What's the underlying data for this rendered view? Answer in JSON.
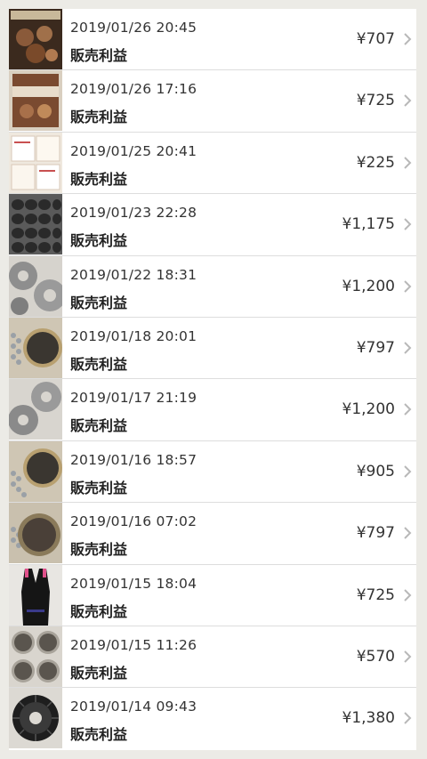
{
  "items": [
    {
      "date": "2019/01/26 20:45",
      "label": "販売利益",
      "amount": "¥707",
      "thumb": "book-cover-cookies",
      "thumb_color": "#6b4a2e"
    },
    {
      "date": "2019/01/26 17:16",
      "label": "販売利益",
      "amount": "¥725",
      "thumb": "book-cover-baking",
      "thumb_color": "#8a5a3a"
    },
    {
      "date": "2019/01/25 20:41",
      "label": "販売利益",
      "amount": "¥225",
      "thumb": "document-sheets",
      "thumb_color": "#e9e2d8"
    },
    {
      "date": "2019/01/23 22:28",
      "label": "販売利益",
      "amount": "¥1,175",
      "thumb": "madeleine-pan",
      "thumb_color": "#4a4a4a"
    },
    {
      "date": "2019/01/22 18:31",
      "label": "販売利益",
      "amount": "¥1,200",
      "thumb": "ring-mold-pans",
      "thumb_color": "#9a9a9a"
    },
    {
      "date": "2019/01/18 20:01",
      "label": "販売利益",
      "amount": "¥797",
      "thumb": "tart-pan-with-beads",
      "thumb_color": "#7a6a4a"
    },
    {
      "date": "2019/01/17 21:19",
      "label": "販売利益",
      "amount": "¥1,200",
      "thumb": "ring-mold-pans",
      "thumb_color": "#9a9a9a"
    },
    {
      "date": "2019/01/16 18:57",
      "label": "販売利益",
      "amount": "¥905",
      "thumb": "tart-pan-with-beads",
      "thumb_color": "#7a6a4a"
    },
    {
      "date": "2019/01/16 07:02",
      "label": "販売利益",
      "amount": "¥797",
      "thumb": "tart-pan-dark",
      "thumb_color": "#5a5046"
    },
    {
      "date": "2019/01/15 18:04",
      "label": "販売利益",
      "amount": "¥725",
      "thumb": "swimsuit-black",
      "thumb_color": "#151515"
    },
    {
      "date": "2019/01/15 11:26",
      "label": "販売利益",
      "amount": "¥570",
      "thumb": "cake-tins-round",
      "thumb_color": "#b0aba3"
    },
    {
      "date": "2019/01/14 09:43",
      "label": "販売利益",
      "amount": "¥1,380",
      "thumb": "bundt-pan-dark",
      "thumb_color": "#2a2a2a"
    }
  ]
}
